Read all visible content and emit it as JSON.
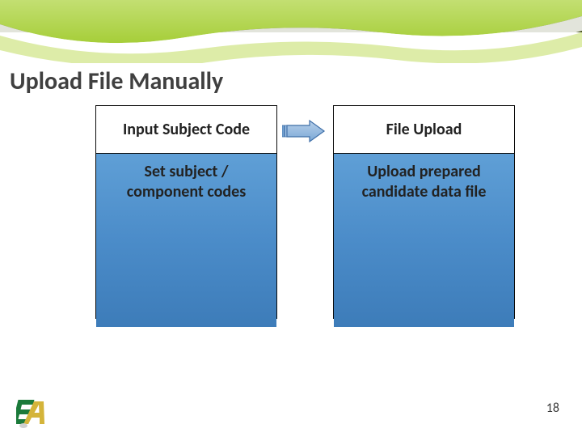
{
  "title": "Upload File Manually",
  "left_panel": {
    "heading": "Input Subject Code",
    "body": "Set subject / component codes"
  },
  "right_panel": {
    "heading": "File Upload",
    "body": "Upload prepared candidate data file"
  },
  "page_number": "18",
  "colors": {
    "accent_green": "#a6ce39",
    "panel_blue_top": "#5f9fd6",
    "panel_blue_bottom": "#3d7cb9",
    "arrow_fill_top": "#9bbde2",
    "arrow_fill_bottom": "#6f9fd0",
    "arrow_stroke": "#3f6fa8"
  },
  "icons": {
    "arrow": "right-arrow-icon",
    "logo": "ea-logo"
  }
}
